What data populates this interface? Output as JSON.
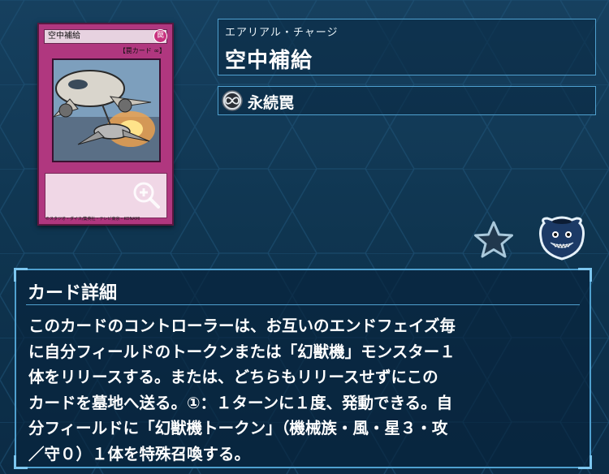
{
  "card": {
    "name": "空中補給",
    "attribute_glyph": "罠",
    "type_line": "【罠カード ∞】",
    "footer": "©スタジオ・ダイス/集英社・テレビ東京・KONAMI"
  },
  "name_panel": {
    "ruby": "エアリアル・チャージ",
    "title": "空中補給"
  },
  "type_panel": {
    "icon": "continuous-icon",
    "label": "永続罠"
  },
  "detail": {
    "heading": "カード詳細",
    "text": "このカードのコントローラーは、お互いのエンドフェイズ毎\nに自分フィールドのトークンまたは「幻獣機」モンスター１\n体をリリースする。または、どちらもリリースせずにこの\nカードを墓地へ送る。①：１ターンに１度、発動できる。自\n分フィールドに「幻獣機トークン」（機械族・風・星３・攻\n／守０）１体を特殊召喚する。"
  },
  "icons": {
    "zoom": "zoom-in-icon",
    "favorite": "star-icon",
    "deck_pot": "pot-of-greed-icon"
  },
  "colors": {
    "background": "#0f3550",
    "panel_border": "#4fa0cf",
    "trap_card": "#b0377f"
  }
}
